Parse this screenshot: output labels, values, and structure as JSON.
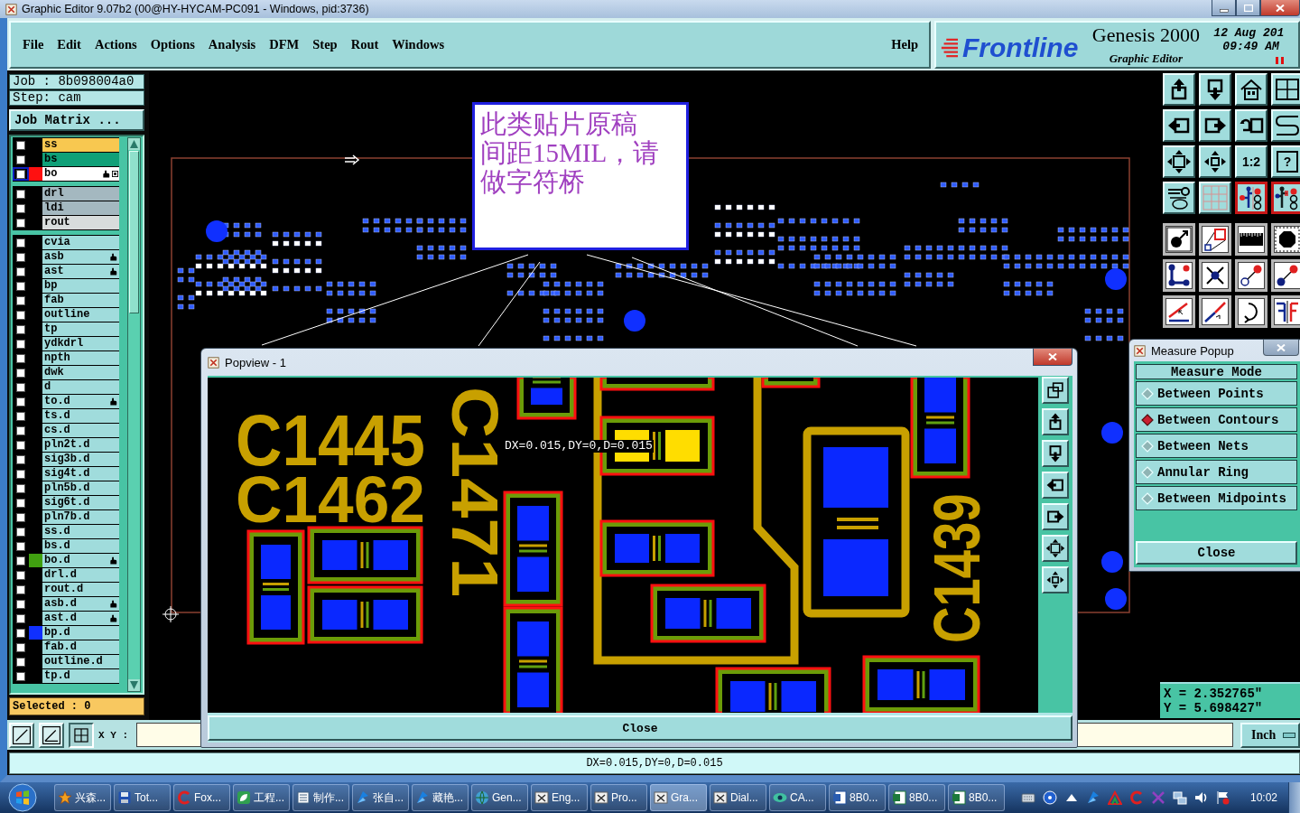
{
  "window": {
    "title": "Graphic Editor 9.07b2 (00@HY-HYCAM-PC091 - Windows, pid:3736)"
  },
  "menu": {
    "items": [
      "File",
      "Edit",
      "Actions",
      "Options",
      "Analysis",
      "DFM",
      "Step",
      "Rout",
      "Windows"
    ],
    "help": "Help"
  },
  "brand": {
    "logo": "Frontline",
    "product": "Genesis 2000",
    "module": "Graphic Editor",
    "date": "12 Aug 201",
    "time": "09:49 AM"
  },
  "job_panel": {
    "job": "Job : 8b098004a0",
    "step": "Step: cam",
    "matrix_button": "Job Matrix ...",
    "layer_groups": [
      [
        {
          "name": "ss",
          "kind": "silk",
          "checked": false,
          "selected": false,
          "tagged": false
        },
        {
          "name": "bs",
          "kind": "mask",
          "checked": false,
          "selected": false,
          "tagged": false
        },
        {
          "name": "bo",
          "color": "#ff1010",
          "checked": false,
          "selected": true,
          "tagged": true
        }
      ],
      [
        {
          "name": "drl",
          "kind": "drill",
          "checked": false,
          "selected": false,
          "tagged": false
        },
        {
          "name": "ldi",
          "kind": "drill",
          "checked": false,
          "selected": false,
          "tagged": false
        },
        {
          "name": "rout",
          "kind": "rout",
          "checked": false,
          "selected": false,
          "tagged": false
        }
      ],
      [
        {
          "name": "cvia",
          "kind": "doc",
          "checked": false,
          "selected": false,
          "tagged": false
        },
        {
          "name": "asb",
          "kind": "doc",
          "checked": false,
          "selected": false,
          "tagged": true
        },
        {
          "name": "ast",
          "kind": "doc",
          "checked": false,
          "selected": false,
          "tagged": true
        },
        {
          "name": "bp",
          "kind": "doc",
          "checked": false,
          "selected": false,
          "tagged": false
        },
        {
          "name": "fab",
          "kind": "doc",
          "checked": false,
          "selected": false,
          "tagged": false
        },
        {
          "name": "outline",
          "kind": "doc",
          "checked": false,
          "selected": false,
          "tagged": false
        },
        {
          "name": "tp",
          "kind": "doc",
          "checked": false,
          "selected": false,
          "tagged": false
        },
        {
          "name": "ydkdrl",
          "kind": "doc",
          "checked": false,
          "selected": false,
          "tagged": false
        },
        {
          "name": "npth",
          "kind": "doc",
          "checked": false,
          "selected": false,
          "tagged": false
        },
        {
          "name": "dwk",
          "kind": "doc",
          "checked": false,
          "selected": false,
          "tagged": false
        },
        {
          "name": "d",
          "kind": "doc",
          "checked": false,
          "selected": false,
          "tagged": false
        },
        {
          "name": "to.d",
          "kind": "doc",
          "checked": false,
          "selected": false,
          "tagged": true
        },
        {
          "name": "ts.d",
          "kind": "doc",
          "checked": false,
          "selected": false,
          "tagged": false
        },
        {
          "name": "cs.d",
          "kind": "doc",
          "checked": false,
          "selected": false,
          "tagged": false
        },
        {
          "name": "pln2t.d",
          "kind": "doc",
          "checked": false,
          "selected": false,
          "tagged": false
        },
        {
          "name": "sig3b.d",
          "kind": "doc",
          "checked": false,
          "selected": false,
          "tagged": false
        },
        {
          "name": "sig4t.d",
          "kind": "doc",
          "checked": false,
          "selected": false,
          "tagged": false
        },
        {
          "name": "pln5b.d",
          "kind": "doc",
          "checked": false,
          "selected": false,
          "tagged": false
        },
        {
          "name": "sig6t.d",
          "kind": "doc",
          "checked": false,
          "selected": false,
          "tagged": false
        },
        {
          "name": "pln7b.d",
          "kind": "doc",
          "checked": false,
          "selected": false,
          "tagged": false
        },
        {
          "name": "ss.d",
          "kind": "doc",
          "checked": false,
          "selected": false,
          "tagged": false
        },
        {
          "name": "bs.d",
          "kind": "doc",
          "checked": false,
          "selected": false,
          "tagged": false
        },
        {
          "name": "bo.d",
          "kind": "doc",
          "color": "#40a010",
          "checked": false,
          "selected": false,
          "tagged": true
        },
        {
          "name": "drl.d",
          "kind": "doc",
          "checked": false,
          "selected": false,
          "tagged": false
        },
        {
          "name": "rout.d",
          "kind": "doc",
          "checked": false,
          "selected": false,
          "tagged": false
        },
        {
          "name": "asb.d",
          "kind": "doc",
          "checked": false,
          "selected": false,
          "tagged": true
        },
        {
          "name": "ast.d",
          "kind": "doc",
          "checked": false,
          "selected": false,
          "tagged": true
        },
        {
          "name": "bp.d",
          "kind": "doc",
          "color": "#1030ff",
          "checked": false,
          "selected": false,
          "tagged": false
        },
        {
          "name": "fab.d",
          "kind": "doc",
          "checked": false,
          "selected": false,
          "tagged": false
        },
        {
          "name": "outline.d",
          "kind": "doc",
          "checked": false,
          "selected": false,
          "tagged": false
        },
        {
          "name": "tp.d",
          "kind": "doc",
          "checked": false,
          "selected": false,
          "tagged": false
        }
      ]
    ],
    "selected_count": "Selected : 0"
  },
  "canvas": {
    "note": "此类贴片原稿间距15MIL，请做字符桥"
  },
  "view_tools": [
    {
      "kind": "move-up",
      "selected": false
    },
    {
      "kind": "move-down",
      "selected": false
    },
    {
      "kind": "home",
      "selected": false
    },
    {
      "kind": "grid-xy",
      "selected": false
    },
    {
      "kind": "arrow-left",
      "selected": false
    },
    {
      "kind": "arrow-right",
      "selected": false
    },
    {
      "kind": "undo-box",
      "selected": false
    },
    {
      "kind": "snake",
      "selected": false
    },
    {
      "kind": "zoom-fit",
      "selected": false
    },
    {
      "kind": "zoom-small",
      "selected": false
    },
    {
      "kind": "ratio",
      "label": "1:2",
      "selected": false
    },
    {
      "kind": "help",
      "label": "?",
      "selected": false
    },
    {
      "kind": "tools",
      "selected": false
    },
    {
      "kind": "grid",
      "selected": false
    },
    {
      "kind": "net-a",
      "selected": true
    },
    {
      "kind": "net-b",
      "selected": true
    }
  ],
  "measure_tools": [
    {
      "kind": "pad-arrow"
    },
    {
      "kind": "pads-pair"
    },
    {
      "kind": "ruler"
    },
    {
      "kind": "octagon"
    },
    {
      "kind": "nodes"
    },
    {
      "kind": "cross-dot"
    },
    {
      "kind": "dot-arrow-open"
    },
    {
      "kind": "dot-arrow-filled"
    },
    {
      "kind": "angle-line"
    },
    {
      "kind": "diagonal-line"
    },
    {
      "kind": "rotate"
    },
    {
      "kind": "mirror-f"
    }
  ],
  "measure_popup": {
    "title": "Measure Popup",
    "heading": "Measure Mode",
    "modes": [
      {
        "label": "Between Points",
        "selected": false
      },
      {
        "label": "Between Contours",
        "selected": true
      },
      {
        "label": "Between Nets",
        "selected": false
      },
      {
        "label": "Annular Ring",
        "selected": false
      },
      {
        "label": "Between Midpoints",
        "selected": false
      }
    ],
    "close": "Close"
  },
  "coordinates": {
    "x": "X = 2.352765\"",
    "y": "Y = 5.698427\""
  },
  "popview": {
    "title": "Popview - 1",
    "readout": "DX=0.015,DY=0,D=0.015",
    "labels": [
      "C1445",
      "C1462",
      "C1471",
      "C1439"
    ],
    "close": "Close"
  },
  "command_bar": {
    "tools": [
      {
        "kind": "snap-line",
        "selected": false
      },
      {
        "kind": "snap-angle",
        "selected": false
      },
      {
        "kind": "grid-snap",
        "selected": true
      }
    ],
    "label": "X Y :",
    "units": "Inch"
  },
  "status": "DX=0.015,DY=0,D=0.015",
  "taskbar": {
    "items": [
      {
        "label": "兴森...",
        "kind": "star",
        "selected": false
      },
      {
        "label": "Tot...",
        "kind": "disk",
        "selected": false
      },
      {
        "label": "Fox...",
        "kind": "arc",
        "selected": false
      },
      {
        "label": "工程...",
        "kind": "leaf",
        "selected": false
      },
      {
        "label": "制作...",
        "kind": "doc",
        "selected": false
      },
      {
        "label": "张自...",
        "kind": "swoosh",
        "selected": false
      },
      {
        "label": "藏艳...",
        "kind": "swoosh",
        "selected": false
      },
      {
        "label": "Gen...",
        "kind": "globe",
        "selected": false
      },
      {
        "label": "Eng...",
        "kind": "window",
        "selected": false
      },
      {
        "label": "Pro...",
        "kind": "window",
        "selected": false
      },
      {
        "label": "Gra...",
        "kind": "window",
        "selected": true
      },
      {
        "label": "Dial...",
        "kind": "window",
        "selected": false
      },
      {
        "label": "CA...",
        "kind": "eye",
        "selected": false
      },
      {
        "label": "8B0...",
        "kind": "word",
        "selected": false
      },
      {
        "label": "8B0...",
        "kind": "excel",
        "selected": false
      },
      {
        "label": "8B0...",
        "kind": "excel",
        "selected": false
      }
    ],
    "clock": "10:02"
  }
}
